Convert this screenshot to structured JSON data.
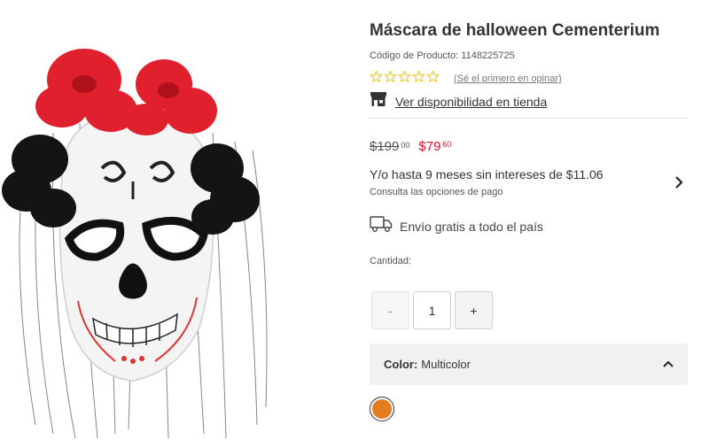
{
  "product": {
    "title": "Máscara de halloween Cementerium",
    "sku": "Código de Producto: 1148225725",
    "review_link": "(Sé el primero en opinar)",
    "store_link": "Ver disponibilidad en tienda",
    "rating": 0,
    "max_rating": 5
  },
  "pricing": {
    "old_price": "$199",
    "old_cents": "00",
    "new_price": "$79",
    "new_cents": "60"
  },
  "installments": {
    "text": "Y/o hasta 9 meses sin intereses de $11.06",
    "subtext": "Consulta las opciones de pago"
  },
  "shipping": {
    "text": "Envío gratis a todo el país"
  },
  "quantity": {
    "label": "Cantidad:",
    "value": "1",
    "minus_label": "-",
    "plus_label": "+"
  },
  "color": {
    "label": "Color:",
    "value": "Multicolor",
    "swatch_color": "#e57c1f"
  },
  "colors": {
    "accent_red": "#e0102b",
    "star_color": "#f2c200",
    "text": "#333333"
  },
  "icons": [
    "star-outline-icon",
    "store-icon",
    "chevron-right-icon",
    "truck-icon",
    "chevron-up-icon"
  ]
}
